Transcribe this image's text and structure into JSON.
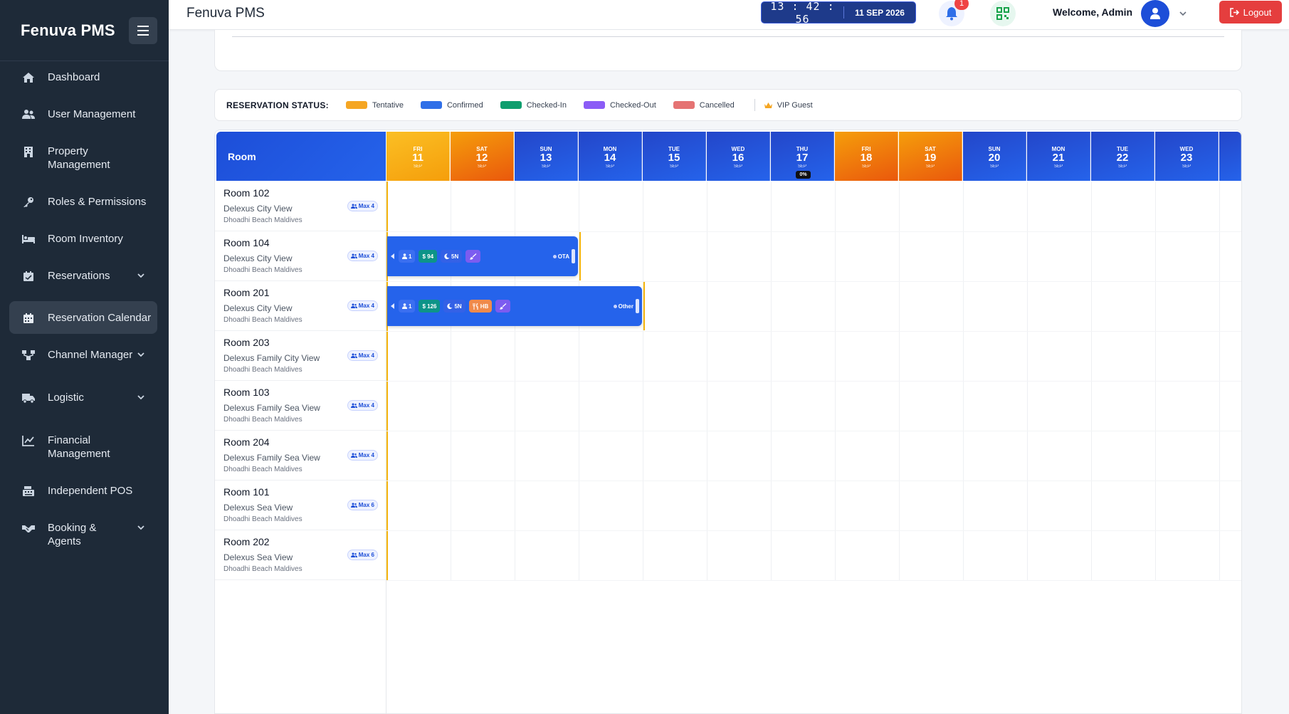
{
  "app": {
    "brand": "Fenuva PMS",
    "page_title": "Fenuva PMS"
  },
  "topbar": {
    "time": "13 : 42 : 56",
    "date": "11 SEP 2026",
    "notification_count": "1",
    "welcome": "Welcome, Admin",
    "logout_label": "Logout"
  },
  "sidebar": {
    "items": [
      {
        "label": "Dashboard",
        "icon": "home-icon"
      },
      {
        "label": "User Management",
        "icon": "users-icon"
      },
      {
        "label": "Property Management",
        "icon": "building-icon"
      },
      {
        "label": "Roles & Permissions",
        "icon": "key-icon"
      },
      {
        "label": "Room Inventory",
        "icon": "bed-icon"
      },
      {
        "label": "Reservations",
        "icon": "calendar-check-icon",
        "expandable": true
      },
      {
        "label": "Reservation Calendar",
        "icon": "calendar-icon",
        "active": true
      },
      {
        "label": "Channel Manager",
        "icon": "sitemap-icon",
        "expandable": true
      },
      {
        "label": "Logistic",
        "icon": "truck-icon",
        "expandable": true
      },
      {
        "label": "Financial Management",
        "icon": "chart-line-icon"
      },
      {
        "label": "Independent POS",
        "icon": "cash-register-icon"
      },
      {
        "label": "Booking & Agents",
        "icon": "handshake-icon",
        "expandable": true
      }
    ]
  },
  "legend": {
    "title": "RESERVATION STATUS:",
    "items": [
      {
        "label": "Tentative",
        "color": "#f5a623"
      },
      {
        "label": "Confirmed",
        "color": "#2f6fe8"
      },
      {
        "label": "Checked-In",
        "color": "#0f9e6e"
      },
      {
        "label": "Checked-Out",
        "color": "#8b5cf6"
      },
      {
        "label": "Cancelled",
        "color": "#e57373"
      }
    ],
    "vip_label": "VIP Guest"
  },
  "calendar": {
    "room_header": "Room",
    "days": [
      {
        "dow": "FRI",
        "num": "11",
        "mon": "SEP",
        "kind": "today"
      },
      {
        "dow": "SAT",
        "num": "12",
        "mon": "SEP",
        "kind": "weekend"
      },
      {
        "dow": "SUN",
        "num": "13",
        "mon": "SEP",
        "kind": "weekday"
      },
      {
        "dow": "MON",
        "num": "14",
        "mon": "SEP",
        "kind": "weekday"
      },
      {
        "dow": "TUE",
        "num": "15",
        "mon": "SEP",
        "kind": "weekday"
      },
      {
        "dow": "WED",
        "num": "16",
        "mon": "SEP",
        "kind": "weekday"
      },
      {
        "dow": "THU",
        "num": "17",
        "mon": "SEP",
        "kind": "weekday",
        "occupancy": "0%"
      },
      {
        "dow": "FRI",
        "num": "18",
        "mon": "SEP",
        "kind": "weekend"
      },
      {
        "dow": "SAT",
        "num": "19",
        "mon": "SEP",
        "kind": "weekend"
      },
      {
        "dow": "SUN",
        "num": "20",
        "mon": "SEP",
        "kind": "weekday"
      },
      {
        "dow": "MON",
        "num": "21",
        "mon": "SEP",
        "kind": "weekday"
      },
      {
        "dow": "TUE",
        "num": "22",
        "mon": "SEP",
        "kind": "weekday"
      },
      {
        "dow": "WED",
        "num": "23",
        "mon": "SEP",
        "kind": "weekday"
      }
    ],
    "rooms": [
      {
        "name": "Room 102",
        "type": "Delexus City View",
        "location": "Dhoadhi Beach Maldives",
        "max": "Max 4"
      },
      {
        "name": "Room 104",
        "type": "Delexus City View",
        "location": "Dhoadhi Beach Maldives",
        "max": "Max 4"
      },
      {
        "name": "Room 201",
        "type": "Delexus City View",
        "location": "Dhoadhi Beach Maldives",
        "max": "Max 4"
      },
      {
        "name": "Room 203",
        "type": "Delexus Family City View",
        "location": "Dhoadhi Beach Maldives",
        "max": "Max 4"
      },
      {
        "name": "Room 103",
        "type": "Delexus Family Sea View",
        "location": "Dhoadhi Beach Maldives",
        "max": "Max 4"
      },
      {
        "name": "Room 204",
        "type": "Delexus Family Sea View",
        "location": "Dhoadhi Beach Maldives",
        "max": "Max 4"
      },
      {
        "name": "Room 101",
        "type": "Delexus Sea View",
        "location": "Dhoadhi Beach Maldives",
        "max": "Max 6"
      },
      {
        "name": "Room 202",
        "type": "Delexus Sea View",
        "location": "Dhoadhi Beach Maldives",
        "max": "Max 6"
      }
    ],
    "bookings": [
      {
        "room": "Room 104",
        "guests": "1",
        "price": "$ 94",
        "nights": "5N",
        "meal": "",
        "source": "OTA",
        "status": "Confirmed"
      },
      {
        "room": "Room 201",
        "guests": "1",
        "price": "$ 126",
        "nights": "5N",
        "meal": "HB",
        "source": "Other",
        "status": "Confirmed"
      }
    ]
  },
  "colors": {
    "sidebar_bg": "#1e2a38",
    "primary": "#2563eb",
    "weekend": "#ea580c",
    "logout": "#e53e3e"
  }
}
